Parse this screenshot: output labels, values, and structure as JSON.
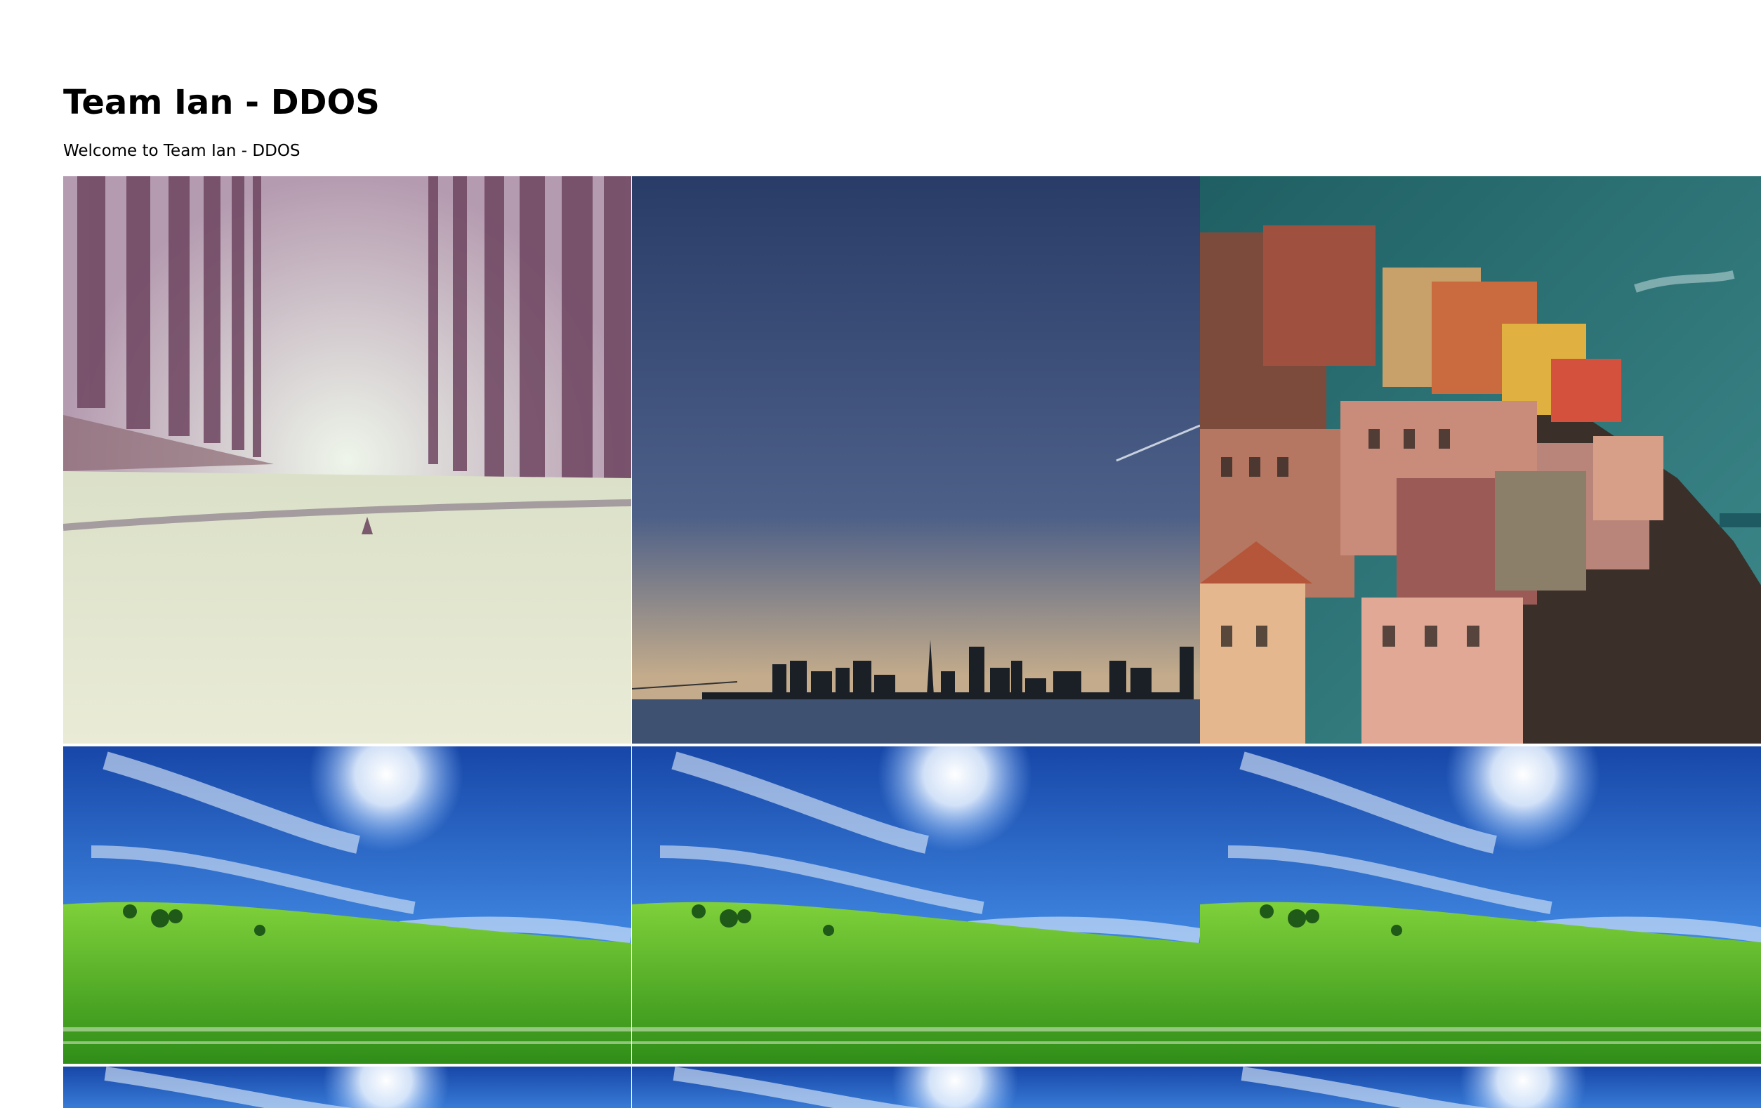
{
  "page": {
    "title": "Team Ian - DDOS",
    "welcome": "Welcome to Team Ian - DDOS"
  },
  "gallery": {
    "images": [
      {
        "name": "misty-tree-lined-road",
        "colors": {
          "sky": "#e6eee0",
          "trees": "#7a4f6a",
          "road": "#e3e6cf"
        }
      },
      {
        "name": "city-skyline-at-dusk",
        "colors": {
          "skyTop": "#2b3f6a",
          "skyBottom": "#b9a58a",
          "water": "#3c4d68"
        }
      },
      {
        "name": "cliffside-colorful-houses",
        "colors": {
          "sky": "#2f7579",
          "houses": "#c77b5c",
          "cliff": "#3b3128"
        }
      },
      {
        "name": "green-field-blue-sky",
        "colors": {
          "sky": "#1f5fc4",
          "grass": "#4cae20"
        }
      },
      {
        "name": "green-field-blue-sky",
        "colors": {
          "sky": "#1f5fc4",
          "grass": "#4cae20"
        }
      },
      {
        "name": "green-field-blue-sky",
        "colors": {
          "sky": "#1f5fc4",
          "grass": "#4cae20"
        }
      },
      {
        "name": "green-field-blue-sky",
        "colors": {
          "sky": "#1f5fc4",
          "grass": "#4cae20"
        }
      },
      {
        "name": "green-field-blue-sky",
        "colors": {
          "sky": "#1f5fc4",
          "grass": "#4cae20"
        }
      },
      {
        "name": "green-field-blue-sky",
        "colors": {
          "sky": "#1f5fc4",
          "grass": "#4cae20"
        }
      }
    ]
  }
}
